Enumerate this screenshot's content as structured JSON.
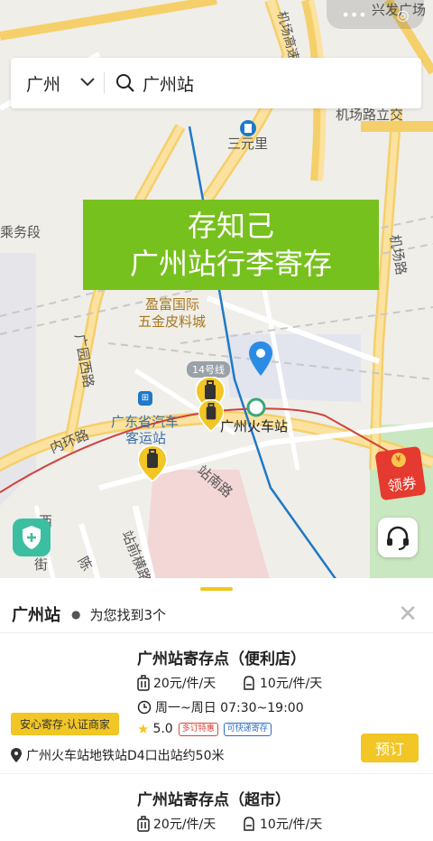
{
  "map": {
    "labels": {
      "xingfa": "兴发广场",
      "jichang_gao": "机场高速",
      "jichang_lu_li": "机场路立交",
      "sanyuanli": "三元里",
      "wuduan": "乘务段",
      "jichang_lu": "机场路",
      "yingfu": "盈富国际",
      "wujin": "五金皮料城",
      "guangyuan_xilu": "广园西路",
      "line14": "14号线",
      "gd_bus1": "广东省汽车",
      "gd_bus2": "客运站",
      "gz_station": "广州火车站",
      "neihuan": "内环路",
      "zhannan": "站南路",
      "zhanqian": "站前横路",
      "xi": "西",
      "jie": "街",
      "chen": "陈"
    },
    "station_metro_icon": "metro-icon"
  },
  "capsule": {
    "more": "•••",
    "close": "◎"
  },
  "search": {
    "city": "广州",
    "query": "广州站"
  },
  "banner": {
    "line1": "存知己",
    "line2": "广州站行李寄存"
  },
  "coupon": {
    "label": "领券",
    "coin": "¥"
  },
  "sheet": {
    "title": "广州站",
    "found": "为您找到3个",
    "close": "✕"
  },
  "stores": [
    {
      "name": "广州站寄存点（便利店）",
      "price_big": "20元/件/天",
      "price_small": "10元/件/天",
      "hours": "周一~周日 07:30~19:00",
      "rating": "5.0",
      "chip1": "多订特惠",
      "chip2": "可快递寄存",
      "badge": "安心寄存·认证商家",
      "address": "广州火车站地铁站D4口出站约50米",
      "book": "预订"
    },
    {
      "name": "广州站寄存点（超市）",
      "price_big": "20元/件/天",
      "price_small": "10元/件/天"
    }
  ],
  "colors": {
    "accent": "#f1c625",
    "banner": "#77c11e",
    "pin_blue": "#2b8ce6",
    "shield": "#3bbfa0"
  }
}
